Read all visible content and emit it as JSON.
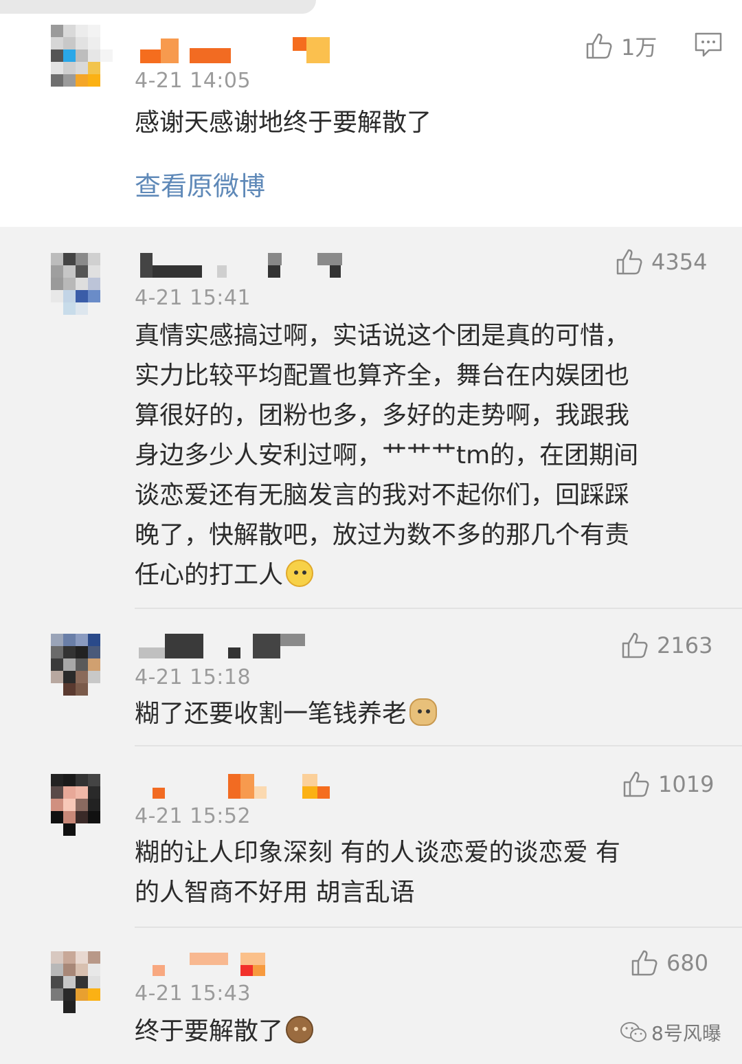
{
  "comments": [
    {
      "time": "4-21 14:05",
      "text": "感谢天感谢地终于要解散了",
      "likes": "1万",
      "link": "查看原微博"
    },
    {
      "time": "4-21 15:41",
      "likes": "4354",
      "lines": [
        "真情实感搞过啊，实话说这个团是真的可惜，",
        "实力比较平均配置也算齐全，舞台在内娱团也",
        "算很好的，团粉也多，多好的走势啊，我跟我",
        "身边多少人安利过啊，艹艹艹tm的，在团期间",
        "谈恋爱还有无脑发言的我对不起你们，回踩踩",
        "晚了，快解散吧，放过为数不多的那几个有责",
        "任心的打工人"
      ],
      "emoji": "thinking-emoji"
    },
    {
      "time": "4-21 15:18",
      "likes": "2163",
      "text": "糊了还要收割一笔钱养老",
      "emoji": "doge-emoji"
    },
    {
      "time": "4-21 15:52",
      "likes": "1019",
      "lines": [
        "糊的让人印象深刻  有的人谈恋爱的谈恋爱  有",
        "的人智商不好用  胡言乱语"
      ]
    },
    {
      "time": "4-21 15:43",
      "likes": "680",
      "text": "终于要解散了",
      "emoji": "see-no-evil-monkey-emoji"
    }
  ],
  "watermark": {
    "text": "8号风曝",
    "icon": "wechat-icon"
  },
  "colors": {
    "link": "#5f89b8",
    "time": "#9b9b9b",
    "like": "#8a8a8a"
  }
}
